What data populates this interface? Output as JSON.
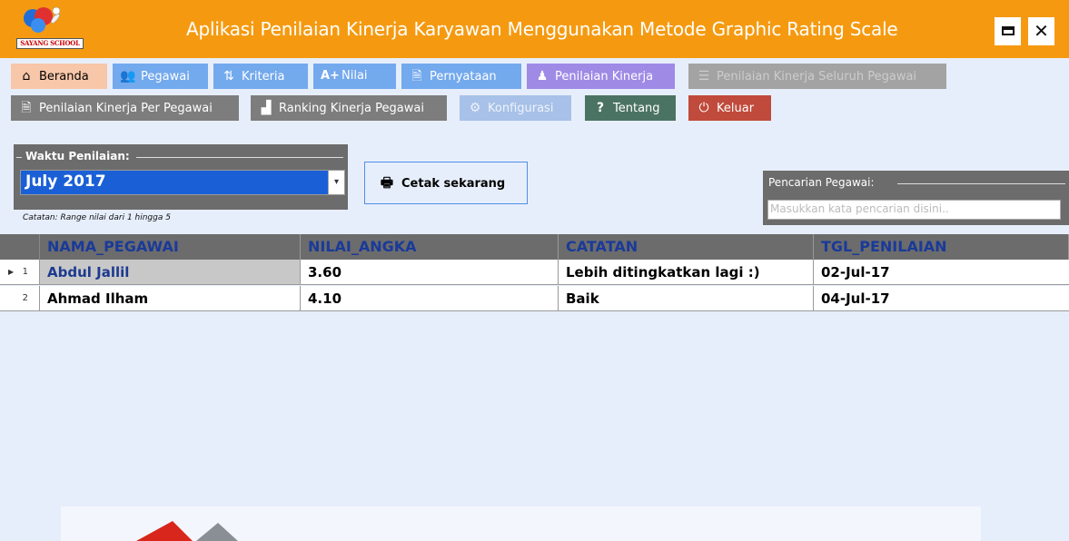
{
  "app": {
    "title": "Aplikasi Penilaian Kinerja Karyawan Menggunakan Metode Graphic Rating Scale",
    "logo_text": "SAYANG SCHOOL",
    "minimize_icon": "minimize-icon",
    "close_label": "✕"
  },
  "menu": {
    "beranda": "Beranda",
    "pegawai": "Pegawai",
    "kriteria": "Kriteria",
    "nilai": "Nilai",
    "pernyataan": "Pernyataan",
    "penilaian_kinerja": "Penilaian Kinerja",
    "penilaian_seluruh": "Penilaian Kinerja Seluruh Pegawai",
    "penilaian_per_pegawai": "Penilaian Kinerja Per Pegawai",
    "ranking": "Ranking Kinerja Pegawai",
    "konfigurasi": "Konfigurasi",
    "tentang": "Tentang",
    "keluar": "Keluar"
  },
  "icons": {
    "beranda": "home-icon",
    "pegawai": "users-icon",
    "kriteria": "sort-filter-icon",
    "nilai": "grade-icon",
    "pernyataan": "document-icon",
    "penilaian_kinerja": "person-icon",
    "penilaian_seluruh": "list-icon",
    "penilaian_per_pegawai": "document-icon",
    "ranking": "podium-icon",
    "konfigurasi": "gear-icon",
    "tentang": "question-icon",
    "keluar": "power-icon",
    "cetak": "printer-icon"
  },
  "waktu": {
    "label": "Waktu Penilaian:",
    "selected": "July 2017",
    "note": "Catatan: Range nilai dari 1 hingga 5"
  },
  "cetak_label": "Cetak sekarang",
  "search": {
    "label": "Pencarian Pegawai:",
    "placeholder": "Masukkan kata pencarian disini.."
  },
  "table": {
    "columns": [
      "NAMA_PEGAWAI",
      "NILAI_ANGKA",
      "CATATAN",
      "TGL_PENILAIAN"
    ],
    "rows": [
      {
        "num": "1",
        "nama": "Abdul Jallil",
        "nilai": "3.60",
        "catatan": "Lebih ditingkatkan lagi :)",
        "tgl": "02-Jul-17"
      },
      {
        "num": "2",
        "nama": "Ahmad Ilham",
        "nilai": "4.10",
        "catatan": "Baik",
        "tgl": "04-Jul-17"
      }
    ]
  },
  "colors": {
    "titlebar": "#f59a10",
    "menu_blue": "#73a9ed",
    "menu_purple": "#9f8ae6",
    "menu_gray": "#7d7d7d",
    "tentang": "#4b7363",
    "keluar": "#c04a3b",
    "background": "#e7eefb",
    "combo_selected": "#1a5fd6"
  }
}
